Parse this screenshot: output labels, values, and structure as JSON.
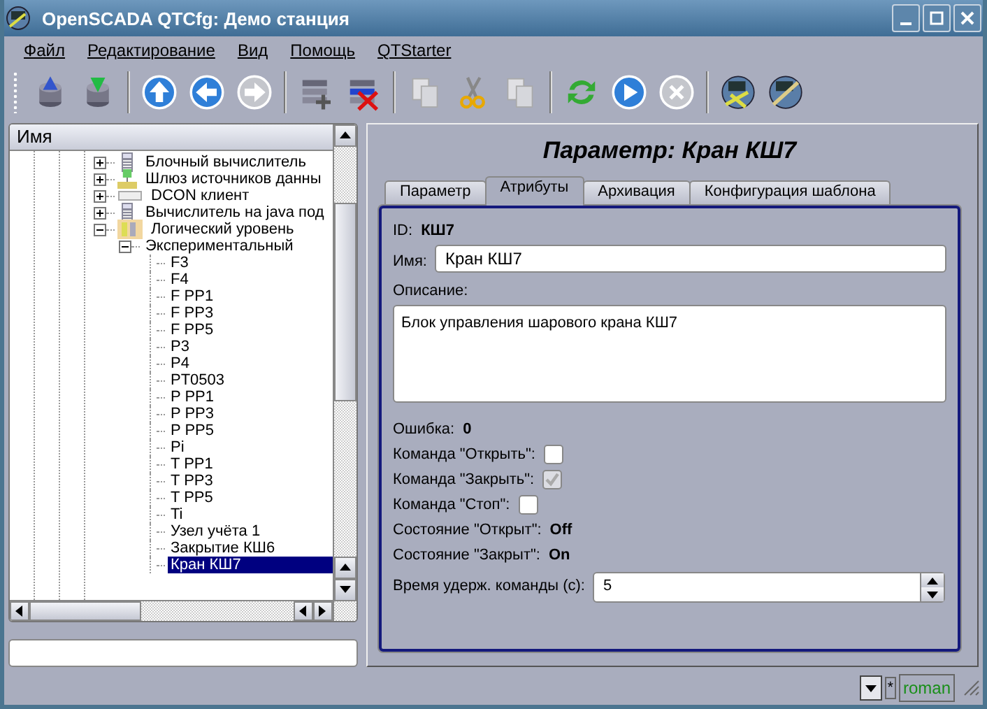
{
  "window": {
    "title": "OpenSCADA QTCfg: Демо станция"
  },
  "menu": [
    "Файл",
    "Редактирование",
    "Вид",
    "Помощь",
    "QTStarter"
  ],
  "toolbar": [
    {
      "kind": "load",
      "disabled": false
    },
    {
      "kind": "save",
      "disabled": false
    },
    {
      "kind": "sep"
    },
    {
      "kind": "up",
      "disabled": false
    },
    {
      "kind": "back",
      "disabled": false
    },
    {
      "kind": "forward",
      "disabled": true
    },
    {
      "kind": "sep"
    },
    {
      "kind": "add",
      "disabled": false
    },
    {
      "kind": "delete",
      "disabled": false
    },
    {
      "kind": "sep"
    },
    {
      "kind": "copy",
      "disabled": true
    },
    {
      "kind": "cut",
      "disabled": false
    },
    {
      "kind": "paste",
      "disabled": true
    },
    {
      "kind": "sep"
    },
    {
      "kind": "refresh",
      "disabled": false
    },
    {
      "kind": "start",
      "disabled": false
    },
    {
      "kind": "stop",
      "disabled": true
    },
    {
      "kind": "sep"
    },
    {
      "kind": "gauge",
      "disabled": false
    },
    {
      "kind": "gauge-link",
      "disabled": false
    }
  ],
  "tree": {
    "header": "Имя",
    "items": [
      {
        "label": "Блочный вычислитель",
        "kind": "calculator",
        "expanded": false,
        "selected": false
      },
      {
        "label": "Шлюз источников данны",
        "kind": "gateway",
        "expanded": false,
        "selected": false
      },
      {
        "label": "DCON клиент",
        "kind": "dcon",
        "expanded": false,
        "selected": false
      },
      {
        "label": "Вычислитель на java под",
        "kind": "calculator",
        "expanded": false,
        "selected": false
      },
      {
        "label": "Логический уровень",
        "kind": "logic",
        "expanded": true,
        "selected": false,
        "children": [
          {
            "label": "Экспериментальный",
            "expanded": true,
            "selected": false,
            "children": [
              {
                "label": "F3",
                "selected": false
              },
              {
                "label": "F4",
                "selected": false
              },
              {
                "label": "F PP1",
                "selected": false
              },
              {
                "label": "F PP3",
                "selected": false
              },
              {
                "label": "F PP5",
                "selected": false
              },
              {
                "label": "P3",
                "selected": false
              },
              {
                "label": "P4",
                "selected": false
              },
              {
                "label": "PT0503",
                "selected": false
              },
              {
                "label": "P PP1",
                "selected": false
              },
              {
                "label": "P PP3",
                "selected": false
              },
              {
                "label": "P PP5",
                "selected": false
              },
              {
                "label": "Pi",
                "selected": false
              },
              {
                "label": "T PP1",
                "selected": false
              },
              {
                "label": "T PP3",
                "selected": false
              },
              {
                "label": "T PP5",
                "selected": false
              },
              {
                "label": "Ti",
                "selected": false
              },
              {
                "label": "Узел учёта 1",
                "selected": false
              },
              {
                "label": "Закрытие КШ6",
                "selected": false
              },
              {
                "label": "Кран КШ7",
                "selected": true
              }
            ]
          }
        ]
      }
    ]
  },
  "page": {
    "title": "Параметр: Кран КШ7",
    "tabs": [
      {
        "label": "Параметр",
        "selected": false
      },
      {
        "label": "Атрибуты",
        "selected": true
      },
      {
        "label": "Архивация",
        "selected": false
      },
      {
        "label": "Конфигурация шаблона",
        "selected": false
      }
    ],
    "fields": [
      {
        "kind": "value",
        "label": "ID:",
        "value": "КШ7"
      },
      {
        "kind": "text",
        "label": "Имя:",
        "value": "Кран КШ7"
      },
      {
        "kind": "textarea",
        "label": "Описание:",
        "value": "Блок управления шарового крана КШ7"
      },
      {
        "kind": "value",
        "label": "Ошибка:",
        "value": "0"
      },
      {
        "kind": "checkbox",
        "label": "Команда \"Открыть\":",
        "checked": false,
        "disabled": false
      },
      {
        "kind": "checkbox",
        "label": "Команда \"Закрыть\":",
        "checked": true,
        "disabled": true
      },
      {
        "kind": "checkbox",
        "label": "Команда \"Стоп\":",
        "checked": false,
        "disabled": false
      },
      {
        "kind": "value",
        "label": "Состояние \"Открыт\":",
        "value": "Off"
      },
      {
        "kind": "value",
        "label": "Состояние \"Закрыт\":",
        "value": "On"
      },
      {
        "kind": "spin",
        "label": "Время удерж. команды (с):",
        "value": "5"
      }
    ]
  },
  "status_bar": {
    "modified": "*",
    "user": "roman"
  }
}
